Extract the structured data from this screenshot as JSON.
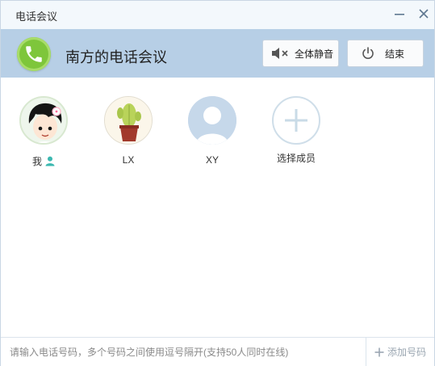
{
  "window": {
    "title": "电话会议"
  },
  "header": {
    "conference_title": "南方的电话会议",
    "mute_all_label": "全体静音",
    "end_label": "结束"
  },
  "members": [
    {
      "name": "我",
      "icon": "user-icon"
    },
    {
      "name": "LX"
    },
    {
      "name": "XY"
    },
    {
      "name": "选择成员"
    }
  ],
  "footer": {
    "input_placeholder": "请输入电话号码，多个号码之间使用逗号隔开(支持50人同时在线)",
    "add_label": "添加号码"
  },
  "colors": {
    "titlebar_bg": "#f3f8fc",
    "header_bg": "#b7cfe6",
    "logo_green": "#7ec63b",
    "owner_icon": "#3cb8b0"
  }
}
